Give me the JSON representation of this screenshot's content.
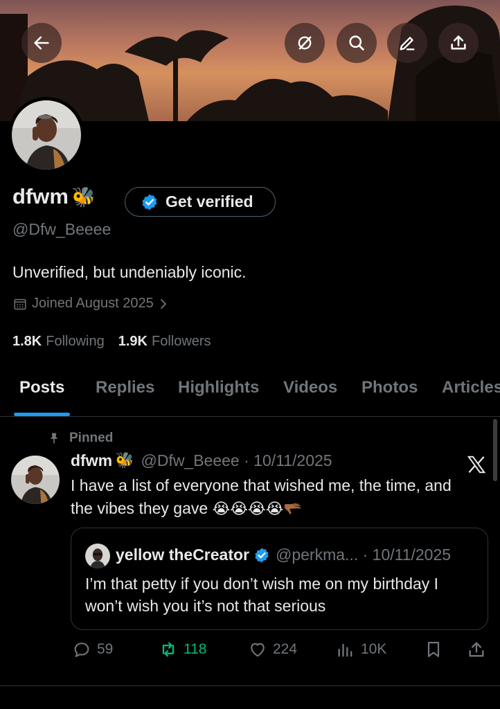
{
  "header": {
    "back_icon": "arrow-left-icon",
    "action_icons": [
      "grok-icon",
      "search-icon",
      "edit-icon",
      "share-icon"
    ]
  },
  "profile": {
    "display_name": "dfwm",
    "name_emoji": "🐝",
    "get_verified_label": "Get verified",
    "handle": "@Dfw_Beeee",
    "bio": "Unverified, but undeniably iconic.",
    "joined": "Joined August 2025",
    "following_count": "1.8K",
    "following_label": "Following",
    "followers_count": "1.9K",
    "followers_label": "Followers"
  },
  "tabs": [
    {
      "label": "Posts",
      "active": true
    },
    {
      "label": "Replies",
      "active": false
    },
    {
      "label": "Highlights",
      "active": false
    },
    {
      "label": "Videos",
      "active": false
    },
    {
      "label": "Photos",
      "active": false
    },
    {
      "label": "Articles",
      "active": false
    }
  ],
  "pinned_post": {
    "pinned_label": "Pinned",
    "author_name": "dfwm",
    "author_emoji": "🐝",
    "meta": "@Dfw_Beeee · 10/11/2025",
    "text_line1": "I have a list of everyone that wished me, the time, and",
    "text_line2": "the vibes they gave",
    "text_emojis": "😭😭😭😭🫳🏾",
    "quote": {
      "author_name": "yellow theCreator",
      "meta": "@perkma... · 10/11/2025",
      "text": "I’m that petty if you don’t wish me on my birthday I won’t wish you it’s not that serious"
    },
    "actions": {
      "replies": "59",
      "reposts": "118",
      "likes": "224",
      "views": "10K"
    }
  },
  "colors": {
    "accent": "#1d9bf0",
    "repost_active": "#00ba7c",
    "muted_text": "#71767b",
    "background": "#000000"
  }
}
